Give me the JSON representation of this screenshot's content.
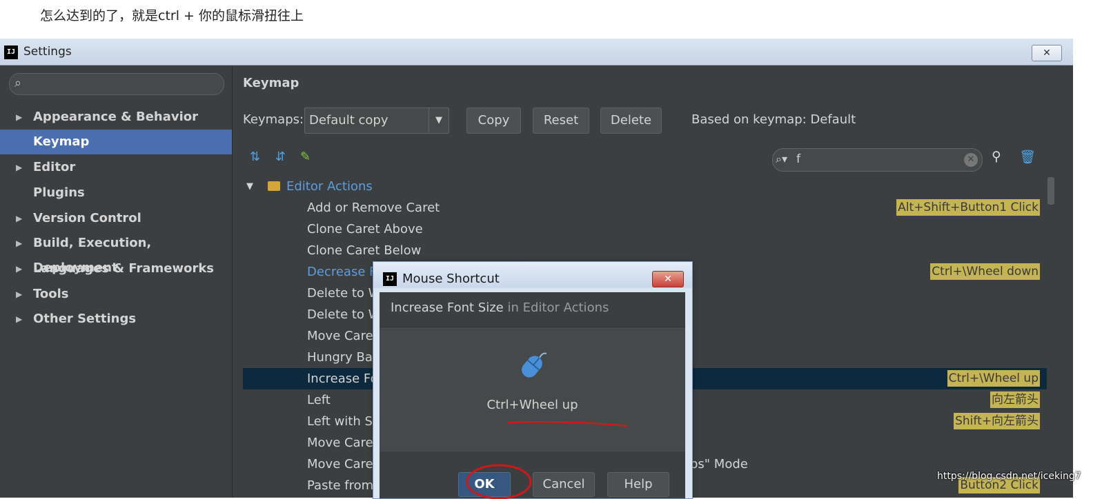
{
  "caption": "怎么达到的了，就是ctrl + 你的鼠标滑扭往上",
  "window": {
    "title": "Settings",
    "close_glyph": "✕"
  },
  "sidebar": {
    "search_placeholder": "",
    "items": [
      {
        "label": "Appearance & Behavior",
        "expandable": true
      },
      {
        "label": "Keymap",
        "expandable": false,
        "selected": true
      },
      {
        "label": "Editor",
        "expandable": true
      },
      {
        "label": "Plugins",
        "expandable": false
      },
      {
        "label": "Version Control",
        "expandable": true
      },
      {
        "label": "Build, Execution, Deployment",
        "expandable": true
      },
      {
        "label": "Languages & Frameworks",
        "expandable": true
      },
      {
        "label": "Tools",
        "expandable": true
      },
      {
        "label": "Other Settings",
        "expandable": true
      }
    ]
  },
  "keymap": {
    "section_title": "Keymap",
    "keymaps_label": "Keymaps:",
    "selected_keymap": "Default copy",
    "buttons": {
      "copy": "Copy",
      "reset": "Reset",
      "delete": "Delete"
    },
    "based_on": "Based on keymap: Default",
    "filter_value": "f"
  },
  "tree": {
    "group": "Editor Actions",
    "rows": [
      {
        "label": "Add or Remove Caret",
        "shortcut": "Alt+Shift+Button1 Click"
      },
      {
        "label": "Clone Caret Above",
        "shortcut": ""
      },
      {
        "label": "Clone Caret Below",
        "shortcut": ""
      },
      {
        "label": "Decrease F",
        "shortcut": "Ctrl+\\Wheel down",
        "link": true
      },
      {
        "label": "Delete to W",
        "shortcut": ""
      },
      {
        "label": "Delete to W",
        "shortcut": ""
      },
      {
        "label": "Move Care",
        "shortcut": ""
      },
      {
        "label": "Hungry Ba",
        "shortcut": ""
      },
      {
        "label": "Increase Fo",
        "shortcut": "Ctrl+\\Wheel up",
        "selected": true
      },
      {
        "label": "Left",
        "shortcut": "向左箭头"
      },
      {
        "label": "Left with Se",
        "shortcut": "Shift+向左箭头"
      },
      {
        "label": "Move Care",
        "shortcut": ""
      },
      {
        "label": "Move Care",
        "shortcut": "",
        "suffix": "ps\" Mode"
      },
      {
        "label": "Paste from",
        "shortcut": "Button2 Click"
      }
    ]
  },
  "dialog": {
    "title": "Mouse Shortcut",
    "close_glyph": "✕",
    "action_name": "Increase Font Size",
    "action_context": " in Editor Actions",
    "shortcut": "Ctrl+Wheel up",
    "buttons": {
      "ok": "OK",
      "cancel": "Cancel",
      "help": "Help"
    }
  },
  "watermark": "https://blog.csdn.net/iceking7",
  "colors": {
    "accent": "#4b6eaf",
    "shortcut_badge": "#c4b454",
    "annotation": "#d01818"
  }
}
